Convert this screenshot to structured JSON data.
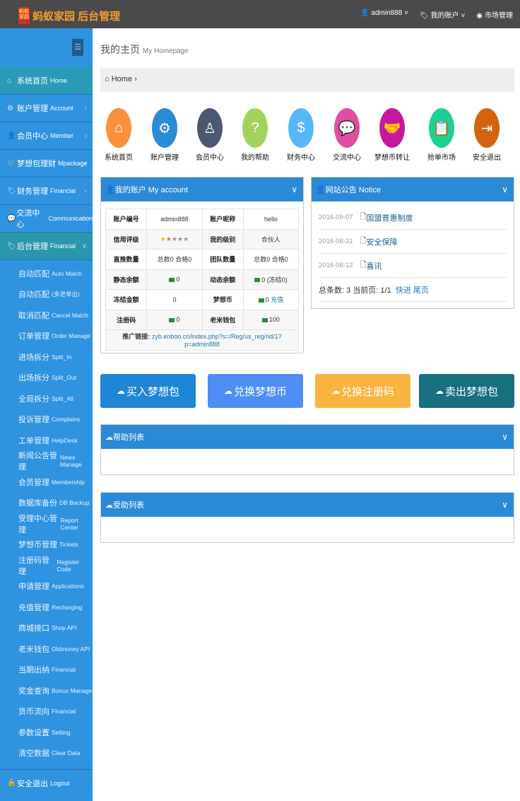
{
  "header": {
    "logo_mark": "蚂蚁家园",
    "brand": "蚂蚁家园 后台管理",
    "user": "admin888",
    "account": "我的账户",
    "market": "市场管理"
  },
  "sidebar": {
    "menu": [
      {
        "cn": "系统首页",
        "en": "Home",
        "icon": "home-icon",
        "glyph": "⌂"
      },
      {
        "cn": "账户管理",
        "en": "Account",
        "icon": "gear-icon",
        "glyph": "⚙"
      },
      {
        "cn": "会员中心",
        "en": "Member",
        "icon": "user-icon",
        "glyph": "👤"
      },
      {
        "cn": "梦想包理财",
        "en": "Mpackage",
        "icon": "cart-icon",
        "glyph": "🛒"
      },
      {
        "cn": "财务管理",
        "en": "Financial",
        "icon": "tag-icon",
        "glyph": "🏷"
      },
      {
        "cn": "交流中心",
        "en": "Communication",
        "icon": "comments-icon",
        "glyph": "💬"
      },
      {
        "cn": "后台管理",
        "en": "Financial",
        "icon": "tag-icon",
        "glyph": "🏷"
      }
    ],
    "sub": [
      {
        "cn": "自动匹配",
        "en": "Auto Match"
      },
      {
        "cn": "自动匹配",
        "en": "(多进单出)"
      },
      {
        "cn": "取消匹配",
        "en": "Cancel Match"
      },
      {
        "cn": "订单管理",
        "en": "Order Manage"
      },
      {
        "cn": "进场拆分",
        "en": "Split_In"
      },
      {
        "cn": "出场拆分",
        "en": "Split_Out"
      },
      {
        "cn": "全局拆分",
        "en": "Split_All"
      },
      {
        "cn": "投诉管理",
        "en": "Complains"
      },
      {
        "cn": "工单管理",
        "en": "HelpDesk"
      },
      {
        "cn": "新闻公告管理",
        "en": "News Manage"
      },
      {
        "cn": "会员管理",
        "en": "Membership"
      },
      {
        "cn": "数据库备份",
        "en": "DB Backup"
      },
      {
        "cn": "受理中心管理",
        "en": "Report Center"
      },
      {
        "cn": "梦想币管理",
        "en": "Tickets"
      },
      {
        "cn": "注册码管理",
        "en": "Register Code"
      },
      {
        "cn": "申请管理",
        "en": "Applications"
      },
      {
        "cn": "充值管理",
        "en": "Recharging"
      },
      {
        "cn": "商城接口",
        "en": "Shop API"
      },
      {
        "cn": "老米钱包",
        "en": "Oldmoney API"
      },
      {
        "cn": "当期出纳",
        "en": "Financial"
      },
      {
        "cn": "奖金查询",
        "en": "Bonus Manage"
      },
      {
        "cn": "货币流向",
        "en": "Financial"
      },
      {
        "cn": "参数设置",
        "en": "Setting"
      },
      {
        "cn": "清空数据",
        "en": "Clear Data"
      }
    ],
    "logout": {
      "cn": "安全退出",
      "en": "Logout"
    }
  },
  "page": {
    "title": "我的主页",
    "title_en": "My Homepage",
    "breadcrumb": "Home"
  },
  "shortcuts": [
    {
      "label": "系统首页",
      "color": "#f7913d",
      "glyph": "⌂",
      "icon": "home-icon"
    },
    {
      "label": "账户管理",
      "color": "#2a8bd6",
      "glyph": "⚙",
      "icon": "gear-icon"
    },
    {
      "label": "会员中心",
      "color": "#4a5870",
      "glyph": "♙",
      "icon": "user-icon"
    },
    {
      "label": "我的帮助",
      "color": "#a3d35b",
      "glyph": "?",
      "icon": "help-icon"
    },
    {
      "label": "财务中心",
      "color": "#55b8f5",
      "glyph": "$",
      "icon": "dollar-icon"
    },
    {
      "label": "交流中心",
      "color": "#dd4fa0",
      "glyph": "💬",
      "icon": "chat-icon"
    },
    {
      "label": "梦想币转让",
      "color": "#c7179f",
      "glyph": "🤝",
      "icon": "handshake-icon"
    },
    {
      "label": "抢单市场",
      "color": "#1fcf8f",
      "glyph": "📋",
      "icon": "clipboard-icon"
    },
    {
      "label": "安全退出",
      "color": "#d4630d",
      "glyph": "⇥",
      "icon": "exit-icon"
    }
  ],
  "account": {
    "title": "我的账户 My account",
    "rows": [
      [
        "账户编号",
        "admin888",
        "账户昵称",
        "hello"
      ],
      [
        "信用评级",
        "",
        "我的级别",
        "合伙人"
      ],
      [
        "直推数量",
        "总数0 合格0",
        "团队数量",
        "总数0 合格0"
      ],
      [
        "静态余额",
        "0",
        "动态余额",
        "0 (冻结0)"
      ],
      [
        "冻结金额",
        "0",
        "梦想币",
        "0"
      ],
      [
        "注册码",
        "0",
        "老米钱包",
        "100"
      ]
    ],
    "recharge": "充值",
    "rating_stars": 1,
    "rating_max": 5,
    "promo_label": "推广链接:",
    "promo_link": "zyb.enboo.cn/index.php?s=/Reg/us_reg/rid/1?p=admin888"
  },
  "notice": {
    "title": "网站公告 Notice",
    "items": [
      {
        "date": "2016-09-07",
        "title": "国盟普惠制度"
      },
      {
        "date": "2016-08-31",
        "title": "安全保障"
      },
      {
        "date": "2016-08-12",
        "title": "喜讯"
      }
    ],
    "summary": "总条数: 3 当前页: 1/1",
    "next": "快进",
    "last": "尾页"
  },
  "actions": [
    {
      "label": "买入梦想包",
      "color": "#1f86d6"
    },
    {
      "label": "兑换梦想币",
      "color": "#4d8ef5"
    },
    {
      "label": "兑换注册码",
      "color": "#f9b440"
    },
    {
      "label": "卖出梦想包",
      "color": "#176f80"
    }
  ],
  "lists": [
    {
      "title": "帮助列表"
    },
    {
      "title": "受助列表"
    }
  ]
}
